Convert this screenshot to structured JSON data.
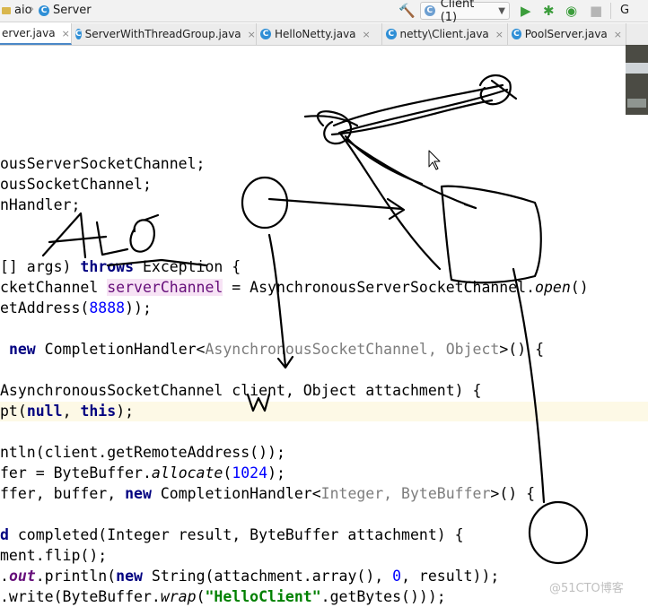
{
  "navbar": {
    "crumb_project": "aio",
    "crumb_class": "Server",
    "class_icon_glyph": "C",
    "run_config": "Client (1)",
    "run_config_icon": "C",
    "extra_label": "G"
  },
  "tabs": [
    {
      "label": "erver.java",
      "active": true
    },
    {
      "label": "ServerWithThreadGroup.java",
      "active": false
    },
    {
      "label": "HelloNetty.java",
      "active": false
    },
    {
      "label": "netty\\Client.java",
      "active": false
    },
    {
      "label": "PoolServer.java",
      "active": false
    }
  ],
  "tab_close_glyph": "×",
  "code": {
    "l1": "ousServerSocketChannel;",
    "l2": "ousSocketChannel;",
    "l3": "nHandler;",
    "l4_a": "[] args) ",
    "l4_kw": "throws",
    "l4_b": " Exception {",
    "l5_a": "cketChannel ",
    "l5_var": "serverChannel",
    "l5_b": " = AsynchronousServerSocketChannel.",
    "l5_m": "open",
    "l5_c": "()",
    "l6_a": "etAddress(",
    "l6_num": "8888",
    "l6_b": "));",
    "l7_a": " ",
    "l7_kw": "new",
    "l7_b": " CompletionHandler<",
    "l7_gen": "AsynchronousSocketChannel, Object",
    "l7_c": ">() {",
    "l8": "AsynchronousSocketChannel client, Object attachment) {",
    "l9_a": "pt(",
    "l9_kw1": "null",
    "l9_b": ", ",
    "l9_kw2": "this",
    "l9_c": ");",
    "l10": "ntln(client.getRemoteAddress());",
    "l11_a": "fer = ByteBuffer.",
    "l11_m": "allocate",
    "l11_b": "(",
    "l11_num": "1024",
    "l11_c": ");",
    "l12_a": "ffer, buffer, ",
    "l12_kw": "new",
    "l12_b": " CompletionHandler<",
    "l12_gen": "Integer, ByteBuffer",
    "l12_c": ">() {",
    "l13_kw": "d",
    "l13_b": " completed(Integer result, ByteBuffer attachment) {",
    "l14": "ment.flip();",
    "l15_a": ".",
    "l15_fld": "out",
    "l15_b": ".println(",
    "l15_kw": "new",
    "l15_c": " String(attachment.array(), ",
    "l15_num": "0",
    "l15_d": ", result));",
    "l16_a": ".write(ByteBuffer.",
    "l16_m": "wrap",
    "l16_b": "(",
    "l16_str": "\"HelloClient\"",
    "l16_c": ".getBytes()));"
  },
  "handwriting": {
    "label": "AIO",
    "ink_color": "#000000"
  },
  "watermark": "@51CTO博客",
  "colors": {
    "keyword": "#000080",
    "number": "#0000ff",
    "string": "#008000",
    "generic": "#7d7d7d",
    "highlight_line": "#fdf9e6",
    "run_green": "#3c9d3c"
  }
}
